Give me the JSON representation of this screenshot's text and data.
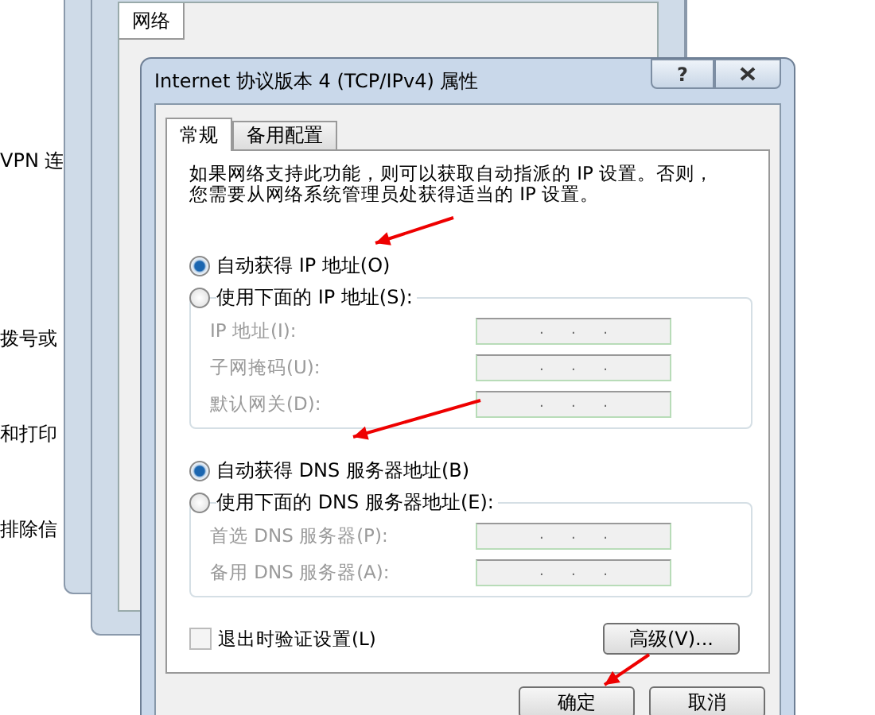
{
  "left_panel_items": [
    "VPN 连",
    "拨号或",
    "和打印",
    "排除信"
  ],
  "back_window": {
    "tab": "网络"
  },
  "dialog": {
    "title": "Internet 协议版本 4 (TCP/IPv4) 属性",
    "help_button": "?",
    "tabs": [
      {
        "label": "常规",
        "selected": true
      },
      {
        "label": "备用配置",
        "selected": false
      }
    ],
    "description": [
      "如果网络支持此功能，则可以获取自动指派的 IP 设置。否则，",
      "您需要从网络系统管理员处获得适当的 IP 设置。"
    ],
    "sections": [
      {
        "options": [
          {
            "label": "自动获得 IP 地址(O)",
            "selected": true
          },
          {
            "label": "使用下面的 IP 地址(S):",
            "selected": false
          }
        ],
        "fields": [
          {
            "label": "IP 地址(I):",
            "value": ".      .      .",
            "disabled": true
          },
          {
            "label": "子网掩码(U):",
            "value": ".      .      .",
            "disabled": true
          },
          {
            "label": "默认网关(D):",
            "value": ".      .      .",
            "disabled": true
          }
        ]
      },
      {
        "options": [
          {
            "label": "自动获得 DNS 服务器地址(B)",
            "selected": true
          },
          {
            "label": "使用下面的 DNS 服务器地址(E):",
            "selected": false
          }
        ],
        "fields": [
          {
            "label": "首选 DNS 服务器(P):",
            "value": ".      .      .",
            "disabled": true
          },
          {
            "label": "备用 DNS 服务器(A):",
            "value": ".      .      .",
            "disabled": true
          }
        ]
      }
    ],
    "validate_checkbox": {
      "label": "退出时验证设置(L)",
      "checked": false,
      "disabled": true
    },
    "advanced_button": "高级(V)...",
    "buttons": [
      "确定",
      "取消"
    ]
  }
}
